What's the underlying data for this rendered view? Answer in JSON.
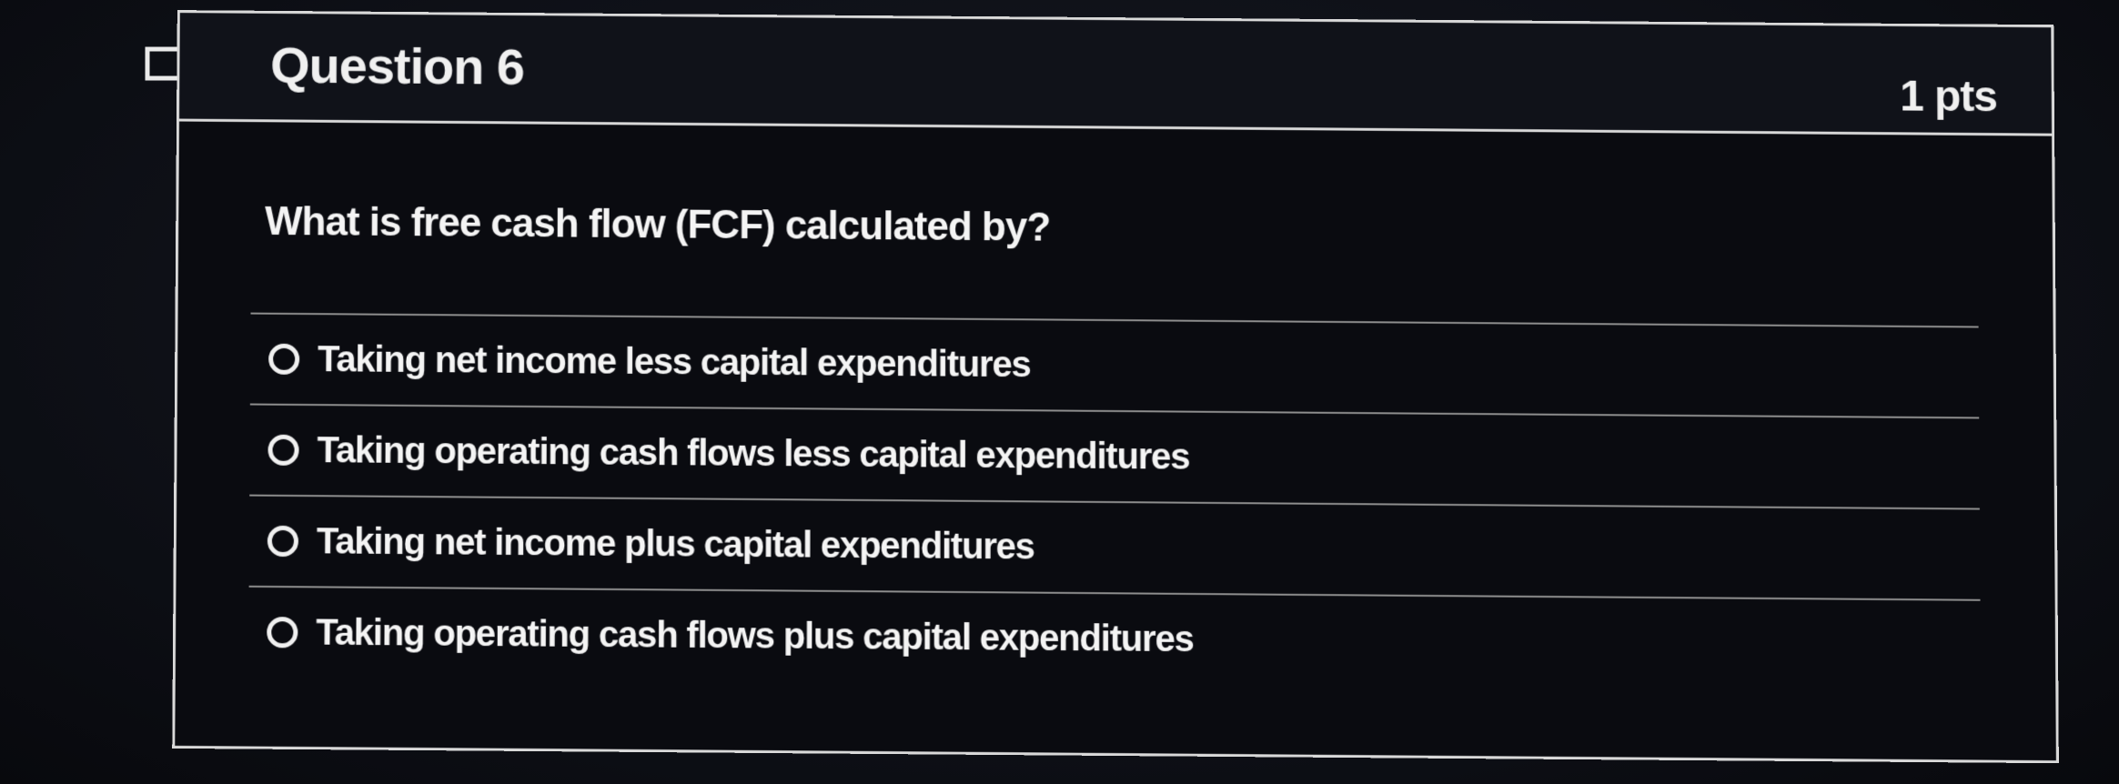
{
  "question": {
    "title": "Question 6",
    "points": "1 pts",
    "text": "What is free cash flow (FCF) calculated by?"
  },
  "flag": {
    "icon": "flag-icon"
  },
  "answers": [
    {
      "label": "Taking net income less capital expenditures",
      "selected": false
    },
    {
      "label": "Taking operating cash flows less capital expenditures",
      "selected": false
    },
    {
      "label": "Taking net income plus capital expenditures",
      "selected": false
    },
    {
      "label": "Taking operating cash flows plus capital expenditures",
      "selected": false
    }
  ],
  "colors": {
    "background": "#0d0f15",
    "border": "#d9d9d9",
    "text": "#f2f2f2"
  }
}
